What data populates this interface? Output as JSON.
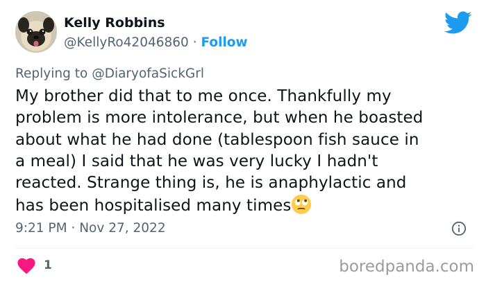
{
  "tweet": {
    "author_name": "Kelly Robbins",
    "handle": "@KellyRo42046860",
    "separator": "·",
    "follow_label": "Follow",
    "reply_prefix": "Replying to",
    "reply_mention": "@DiaryofaSickGrl",
    "lines": [
      "My brother did that to me once. Thankfully my",
      "problem is more intolerance, but when he boasted",
      "about what he had done (tablespoon fish sauce in",
      "a meal) I said that he was very lucky I hadn't",
      "reacted. Strange thing is, he is anaphylactic and",
      "has been hospitalised many times"
    ],
    "emoji": "face-with-rolling-eyes",
    "time": "9:21 PM",
    "date": "Nov 27, 2022",
    "like_count": "1"
  },
  "icons": {
    "avatar": "pug-avatar",
    "brand": "twitter-bird-icon",
    "info": "info-icon",
    "like": "heart-icon"
  },
  "colors": {
    "brand_blue": "#1d9bf0",
    "heart_pink": "#f91880",
    "secondary_text": "#536471",
    "primary_text": "#0f1419",
    "watermark": "#9b9b9b"
  },
  "watermark": "boredpanda.com"
}
